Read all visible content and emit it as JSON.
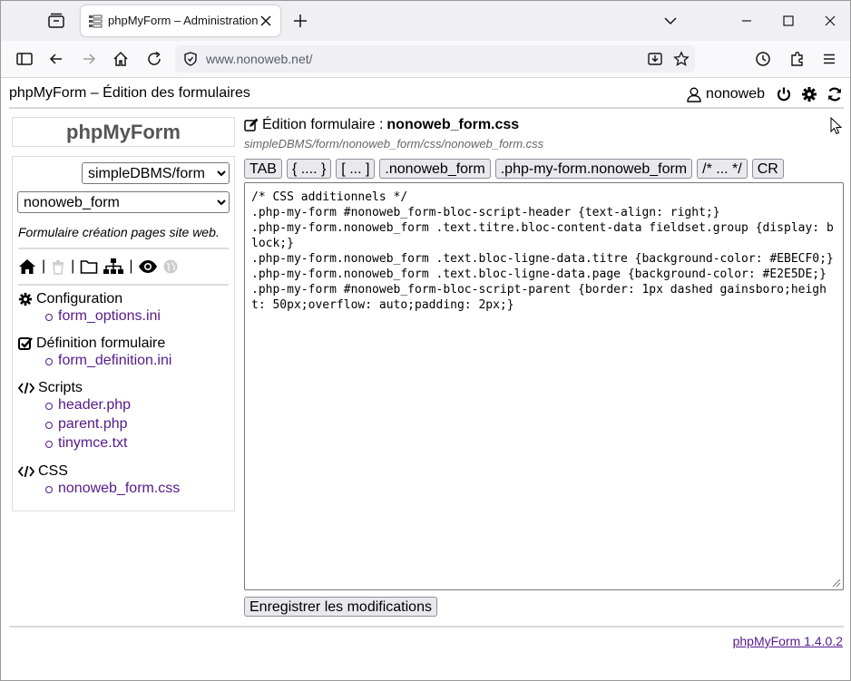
{
  "browser": {
    "tab_title": "phpMyForm – Administration",
    "url": "www.nonoweb.net/"
  },
  "app": {
    "title": "phpMyForm – Édition des formulaires",
    "username": "nonoweb",
    "logo": "phpMyForm",
    "version": "phpMyForm 1.4.0.2"
  },
  "sidebar": {
    "database_select": "simpleDBMS/form",
    "form_select": "nonoweb_form",
    "description": "Formulaire création pages site web.",
    "sections": [
      {
        "label": "Configuration",
        "icon": "gear-icon",
        "items": [
          "form_options.ini"
        ]
      },
      {
        "label": "Définition formulaire",
        "icon": "checkbox-icon",
        "items": [
          "form_definition.ini"
        ]
      },
      {
        "label": "Scripts",
        "icon": "code-icon",
        "items": [
          "header.php",
          "parent.php",
          "tinymce.txt"
        ]
      },
      {
        "label": "CSS",
        "icon": "code-icon",
        "items": [
          "nonoweb_form.css"
        ]
      }
    ]
  },
  "editor": {
    "heading_prefix": "Édition formulaire :",
    "heading_file": "nonoweb_form.css",
    "path": "simpleDBMS/form/nonoweb_form/css/nonoweb_form.css",
    "insert_buttons": [
      "TAB",
      "{ .... }",
      "[ ... ]",
      ".nonoweb_form",
      ".php-my-form.nonoweb_form",
      "/* ... */",
      "CR"
    ],
    "content": "/* CSS additionnels */\n.php-my-form #nonoweb_form-bloc-script-header {text-align: right;}\n.php-my-form.nonoweb_form .text.titre.bloc-content-data fieldset.group {display: block;}\n.php-my-form.nonoweb_form .text.bloc-ligne-data.titre {background-color: #EBECF0;}\n.php-my-form.nonoweb_form .text.bloc-ligne-data.page {background-color: #E2E5DE;}\n.php-my-form #nonoweb_form-bloc-script-parent {border: 1px dashed gainsboro;height: 50px;overflow: auto;padding: 2px;}",
    "save_label": "Enregistrer les modifications"
  }
}
